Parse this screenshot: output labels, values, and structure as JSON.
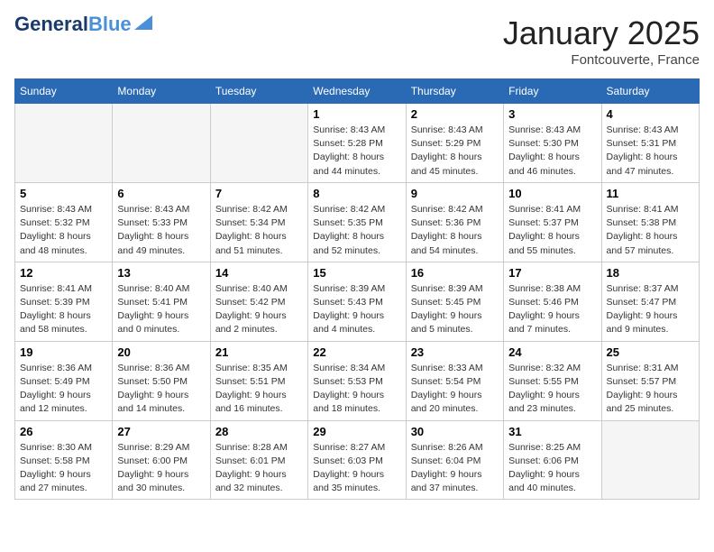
{
  "header": {
    "logo_main": "General",
    "logo_accent": "Blue",
    "month": "January 2025",
    "location": "Fontcouverte, France"
  },
  "weekdays": [
    "Sunday",
    "Monday",
    "Tuesday",
    "Wednesday",
    "Thursday",
    "Friday",
    "Saturday"
  ],
  "weeks": [
    [
      {
        "day": "",
        "info": ""
      },
      {
        "day": "",
        "info": ""
      },
      {
        "day": "",
        "info": ""
      },
      {
        "day": "1",
        "info": "Sunrise: 8:43 AM\nSunset: 5:28 PM\nDaylight: 8 hours\nand 44 minutes."
      },
      {
        "day": "2",
        "info": "Sunrise: 8:43 AM\nSunset: 5:29 PM\nDaylight: 8 hours\nand 45 minutes."
      },
      {
        "day": "3",
        "info": "Sunrise: 8:43 AM\nSunset: 5:30 PM\nDaylight: 8 hours\nand 46 minutes."
      },
      {
        "day": "4",
        "info": "Sunrise: 8:43 AM\nSunset: 5:31 PM\nDaylight: 8 hours\nand 47 minutes."
      }
    ],
    [
      {
        "day": "5",
        "info": "Sunrise: 8:43 AM\nSunset: 5:32 PM\nDaylight: 8 hours\nand 48 minutes."
      },
      {
        "day": "6",
        "info": "Sunrise: 8:43 AM\nSunset: 5:33 PM\nDaylight: 8 hours\nand 49 minutes."
      },
      {
        "day": "7",
        "info": "Sunrise: 8:42 AM\nSunset: 5:34 PM\nDaylight: 8 hours\nand 51 minutes."
      },
      {
        "day": "8",
        "info": "Sunrise: 8:42 AM\nSunset: 5:35 PM\nDaylight: 8 hours\nand 52 minutes."
      },
      {
        "day": "9",
        "info": "Sunrise: 8:42 AM\nSunset: 5:36 PM\nDaylight: 8 hours\nand 54 minutes."
      },
      {
        "day": "10",
        "info": "Sunrise: 8:41 AM\nSunset: 5:37 PM\nDaylight: 8 hours\nand 55 minutes."
      },
      {
        "day": "11",
        "info": "Sunrise: 8:41 AM\nSunset: 5:38 PM\nDaylight: 8 hours\nand 57 minutes."
      }
    ],
    [
      {
        "day": "12",
        "info": "Sunrise: 8:41 AM\nSunset: 5:39 PM\nDaylight: 8 hours\nand 58 minutes."
      },
      {
        "day": "13",
        "info": "Sunrise: 8:40 AM\nSunset: 5:41 PM\nDaylight: 9 hours\nand 0 minutes."
      },
      {
        "day": "14",
        "info": "Sunrise: 8:40 AM\nSunset: 5:42 PM\nDaylight: 9 hours\nand 2 minutes."
      },
      {
        "day": "15",
        "info": "Sunrise: 8:39 AM\nSunset: 5:43 PM\nDaylight: 9 hours\nand 4 minutes."
      },
      {
        "day": "16",
        "info": "Sunrise: 8:39 AM\nSunset: 5:45 PM\nDaylight: 9 hours\nand 5 minutes."
      },
      {
        "day": "17",
        "info": "Sunrise: 8:38 AM\nSunset: 5:46 PM\nDaylight: 9 hours\nand 7 minutes."
      },
      {
        "day": "18",
        "info": "Sunrise: 8:37 AM\nSunset: 5:47 PM\nDaylight: 9 hours\nand 9 minutes."
      }
    ],
    [
      {
        "day": "19",
        "info": "Sunrise: 8:36 AM\nSunset: 5:49 PM\nDaylight: 9 hours\nand 12 minutes."
      },
      {
        "day": "20",
        "info": "Sunrise: 8:36 AM\nSunset: 5:50 PM\nDaylight: 9 hours\nand 14 minutes."
      },
      {
        "day": "21",
        "info": "Sunrise: 8:35 AM\nSunset: 5:51 PM\nDaylight: 9 hours\nand 16 minutes."
      },
      {
        "day": "22",
        "info": "Sunrise: 8:34 AM\nSunset: 5:53 PM\nDaylight: 9 hours\nand 18 minutes."
      },
      {
        "day": "23",
        "info": "Sunrise: 8:33 AM\nSunset: 5:54 PM\nDaylight: 9 hours\nand 20 minutes."
      },
      {
        "day": "24",
        "info": "Sunrise: 8:32 AM\nSunset: 5:55 PM\nDaylight: 9 hours\nand 23 minutes."
      },
      {
        "day": "25",
        "info": "Sunrise: 8:31 AM\nSunset: 5:57 PM\nDaylight: 9 hours\nand 25 minutes."
      }
    ],
    [
      {
        "day": "26",
        "info": "Sunrise: 8:30 AM\nSunset: 5:58 PM\nDaylight: 9 hours\nand 27 minutes."
      },
      {
        "day": "27",
        "info": "Sunrise: 8:29 AM\nSunset: 6:00 PM\nDaylight: 9 hours\nand 30 minutes."
      },
      {
        "day": "28",
        "info": "Sunrise: 8:28 AM\nSunset: 6:01 PM\nDaylight: 9 hours\nand 32 minutes."
      },
      {
        "day": "29",
        "info": "Sunrise: 8:27 AM\nSunset: 6:03 PM\nDaylight: 9 hours\nand 35 minutes."
      },
      {
        "day": "30",
        "info": "Sunrise: 8:26 AM\nSunset: 6:04 PM\nDaylight: 9 hours\nand 37 minutes."
      },
      {
        "day": "31",
        "info": "Sunrise: 8:25 AM\nSunset: 6:06 PM\nDaylight: 9 hours\nand 40 minutes."
      },
      {
        "day": "",
        "info": ""
      }
    ]
  ]
}
